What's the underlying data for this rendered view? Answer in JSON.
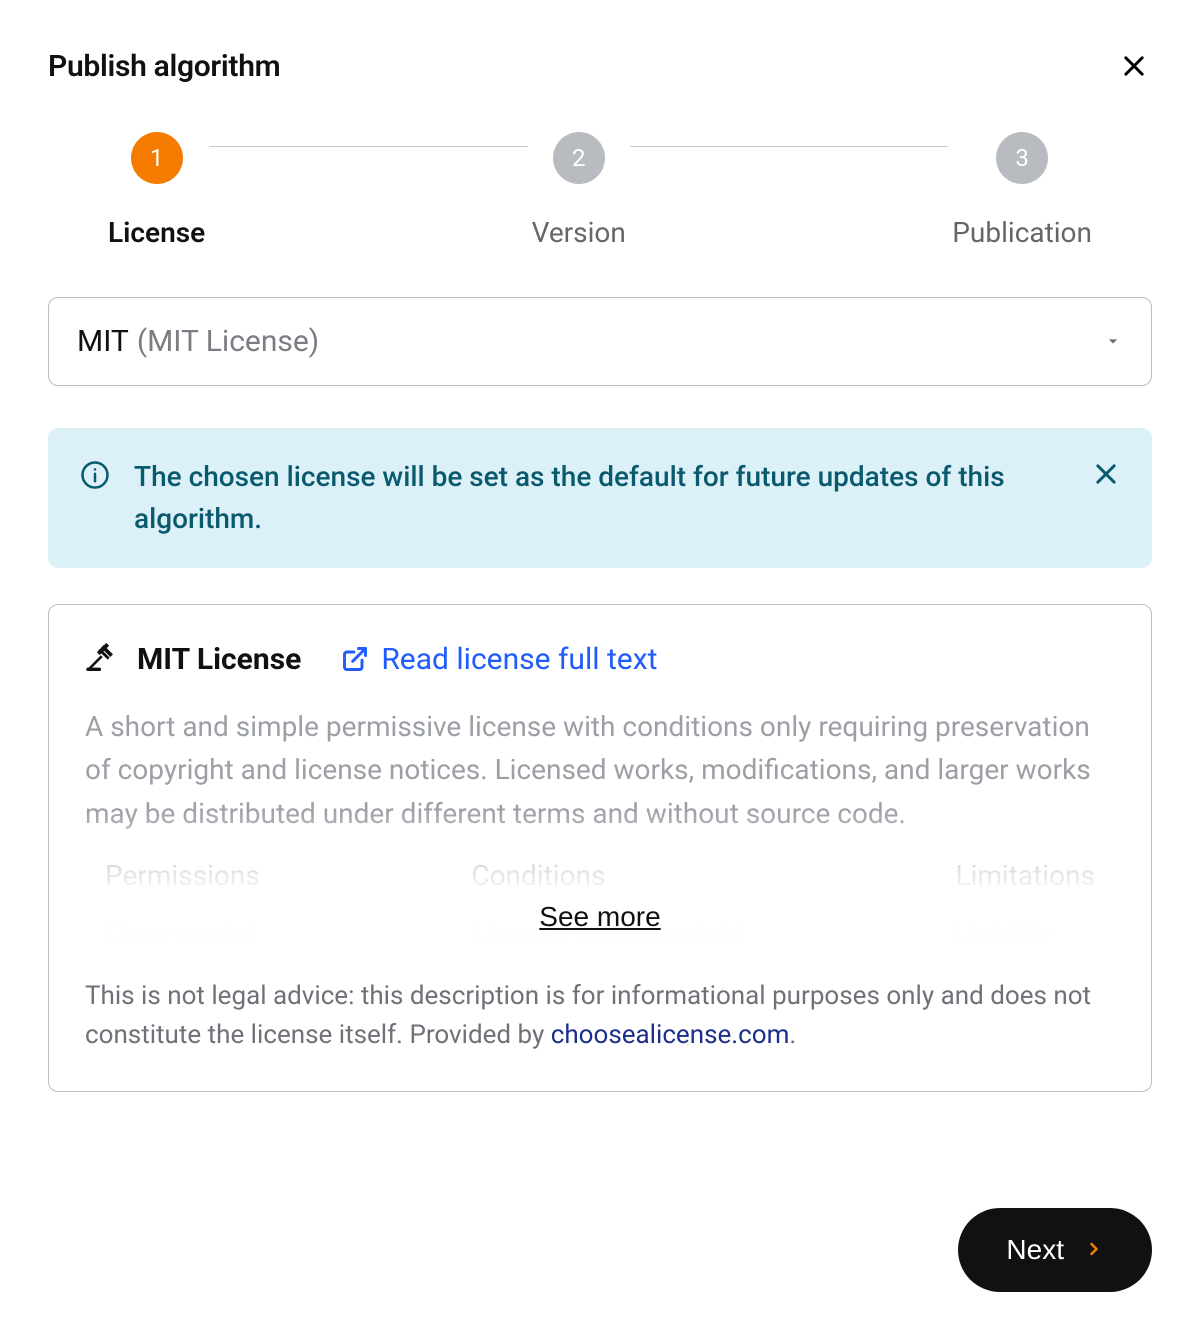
{
  "header": {
    "title": "Publish algorithm"
  },
  "stepper": {
    "steps": [
      {
        "num": "1",
        "label": "License",
        "active": true
      },
      {
        "num": "2",
        "label": "Version",
        "active": false
      },
      {
        "num": "3",
        "label": "Publication",
        "active": false
      }
    ]
  },
  "select": {
    "main": "MIT",
    "sub": "(MIT License)"
  },
  "alert": {
    "text": "The chosen license will be set as the default for future updates of this algorithm."
  },
  "license": {
    "name": "MIT License",
    "read_link": "Read license full text",
    "description": "A short and simple permissive license with conditions only requiring preservation of copyright and license notices. Licensed works, modifications, and larger works may be distributed under different terms and without source code.",
    "cols": {
      "permissions": {
        "header": "Permissions",
        "item": "Commercial"
      },
      "conditions": {
        "header": "Conditions",
        "item": "License and copyright"
      },
      "limitations": {
        "header": "Limitations",
        "item": "Liability"
      }
    },
    "see_more": "See more",
    "disclaimer_pre": "This is not legal advice: this description is for informational purposes only and does not constitute the license itself. Provided by ",
    "disclaimer_link": "choosealicense.com",
    "disclaimer_post": "."
  },
  "footer": {
    "next": "Next"
  }
}
